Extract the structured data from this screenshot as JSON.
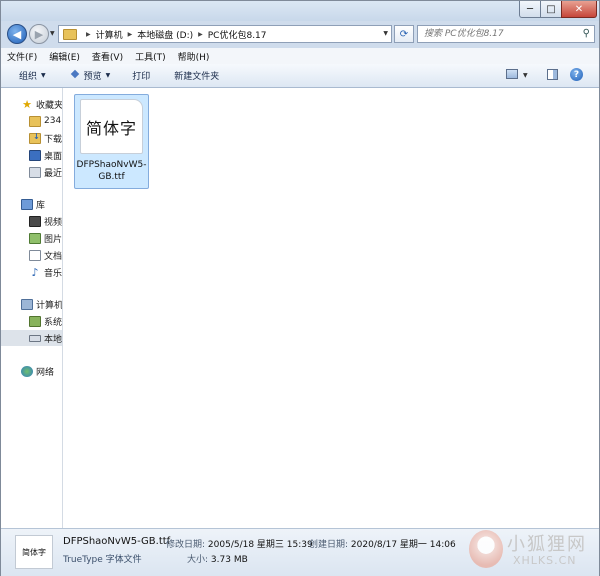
{
  "window": {
    "controls": {
      "minimize": "─",
      "maximize": "□",
      "close": "✕"
    }
  },
  "address_bar": {
    "breadcrumbs": [
      "计算机",
      "本地磁盘 (D:)",
      "PC优化包8.17"
    ],
    "search_placeholder": "搜索 PC优化包8.17"
  },
  "menu": [
    "文件(F)",
    "编辑(E)",
    "查看(V)",
    "工具(T)",
    "帮助(H)"
  ],
  "toolbar": {
    "organize": "组织",
    "preview": "预览",
    "print": "打印",
    "new_folder": "新建文件夹"
  },
  "nav": {
    "favorites": "收藏夹",
    "fav_items": [
      "234",
      "下载",
      "桌面",
      "最近"
    ],
    "libraries": "库",
    "lib_items": [
      "视频",
      "图片",
      "文档",
      "音乐"
    ],
    "computer": "计算机",
    "comp_items": [
      "系统",
      "本地"
    ],
    "network": "网络"
  },
  "files": [
    {
      "name": "DFPShaoNvW5-GB.ttf",
      "thumbnail_text": "简体字"
    }
  ],
  "details": {
    "name": "DFPShaoNvW5-GB.ttf",
    "type": "TrueType 字体文件",
    "thumbnail_text": "简体字",
    "modified_label": "修改日期:",
    "modified_value": "2005/5/18 星期三 15:39",
    "created_label": "创建日期:",
    "created_value": "2020/8/17 星期一 14:06",
    "size_label": "大小:",
    "size_value": "3.73 MB"
  },
  "watermark": {
    "text": "小狐狸网",
    "url": "XHLKS.CN"
  }
}
